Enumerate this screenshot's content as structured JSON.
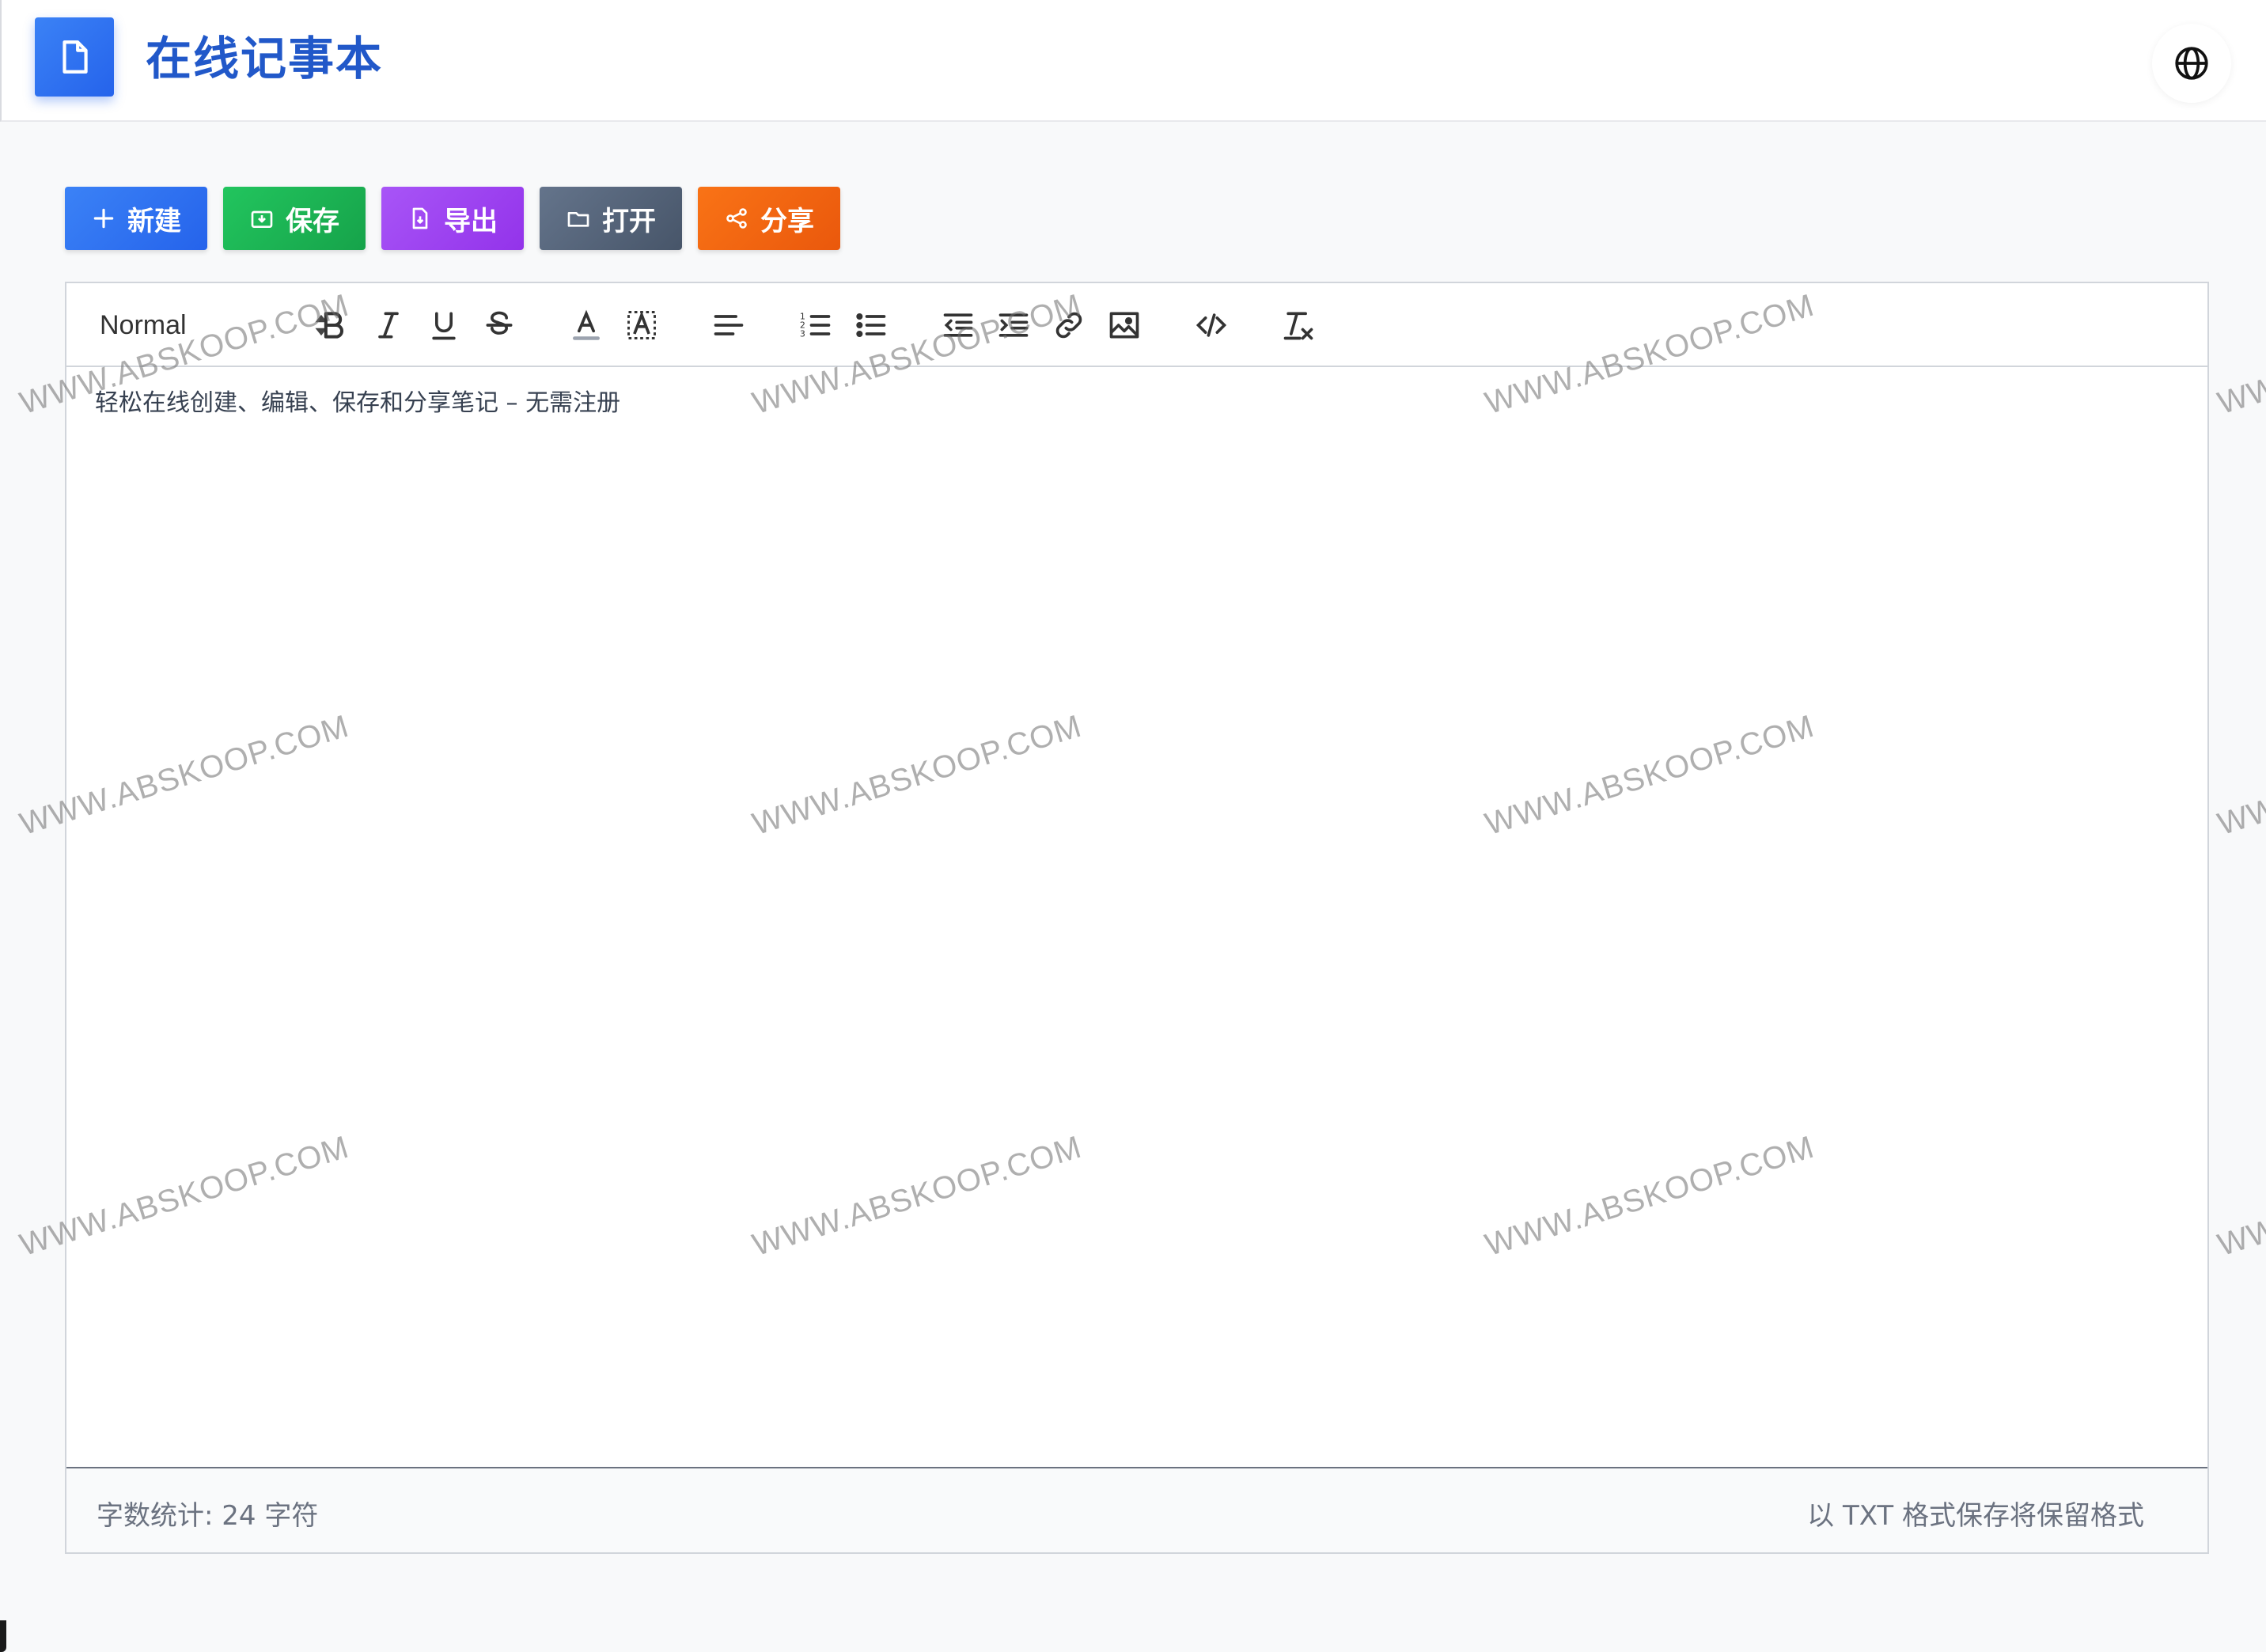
{
  "header": {
    "title": "在线记事本",
    "logo_icon": "document-icon",
    "language_icon": "globe-icon"
  },
  "actions": [
    {
      "label": "新建",
      "icon": "plus-icon",
      "color": "#2563eb"
    },
    {
      "label": "保存",
      "icon": "download-icon",
      "color": "#16a34a"
    },
    {
      "label": "导出",
      "icon": "export-icon",
      "color": "#9333ea"
    },
    {
      "label": "打开",
      "icon": "folder-icon",
      "color": "#475569"
    },
    {
      "label": "分享",
      "icon": "share-icon",
      "color": "#ea580c"
    }
  ],
  "toolbar": {
    "format_select": "Normal",
    "tools": [
      "bold-icon",
      "italic-icon",
      "underline-icon",
      "strike-icon",
      "text-color-icon",
      "highlight-icon",
      "align-icon",
      "ordered-list-icon",
      "bullet-list-icon",
      "outdent-icon",
      "indent-icon",
      "link-icon",
      "image-icon",
      "code-icon",
      "clear-format-icon"
    ]
  },
  "editor": {
    "content": "轻松在线创建、编辑、保存和分享笔记 – 无需注册"
  },
  "footer": {
    "word_count": "字数统计: 24 字符",
    "hint": "以 TXT 格式保存将保留格式"
  },
  "watermark": "WWW.ABSKOOP.COM"
}
